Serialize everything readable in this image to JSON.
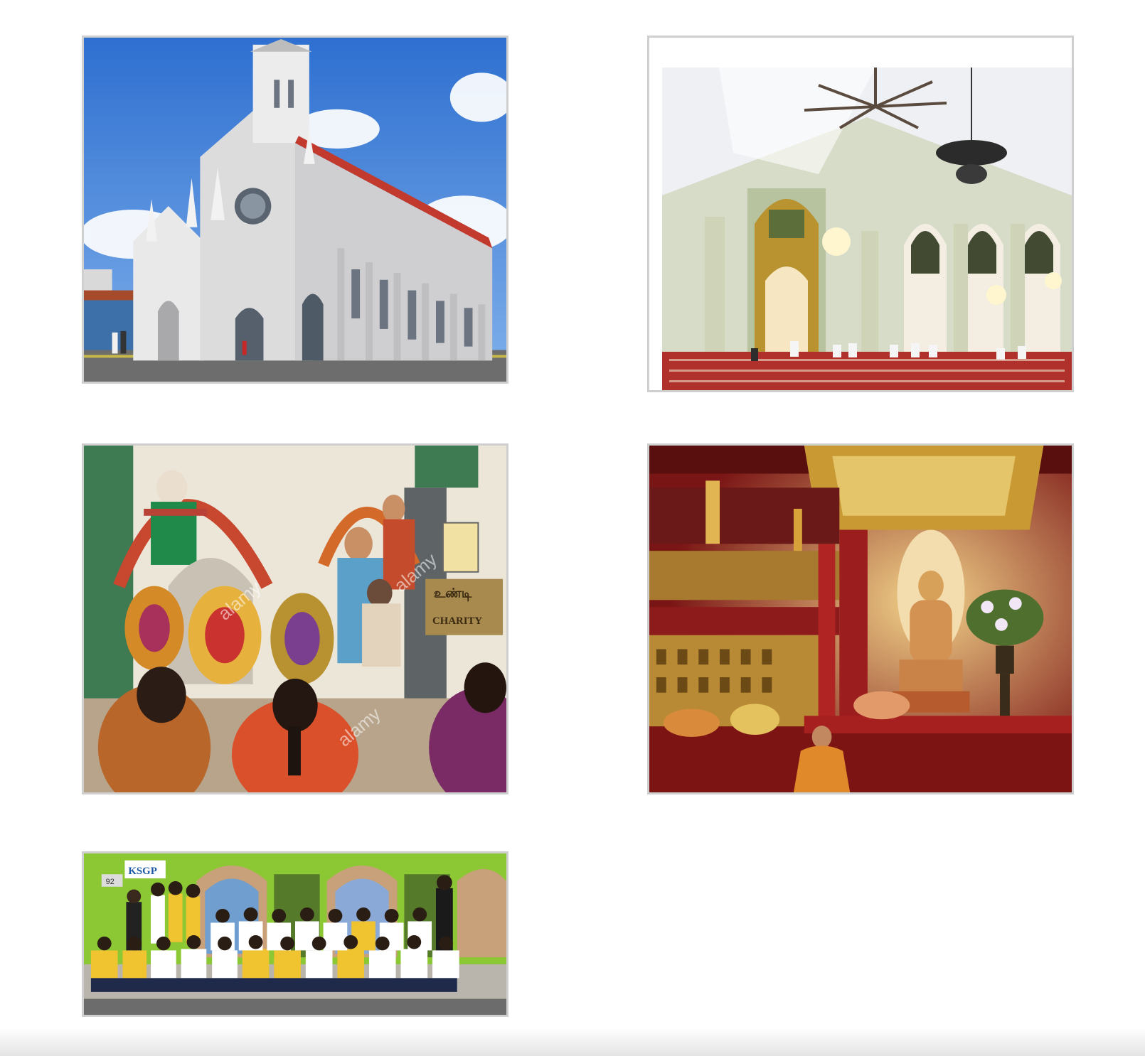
{
  "gallery": {
    "photos": [
      {
        "name": "church-photo",
        "subject": "church"
      },
      {
        "name": "mosque-interior-photo",
        "subject": "mosque"
      },
      {
        "name": "hindu-temple-photo",
        "subject": "hindu-temple",
        "watermark": "alamy",
        "sign_tamil": "உண்டி",
        "sign_charity": "CHARITY"
      },
      {
        "name": "buddhist-temple-photo",
        "subject": "buddhist-temple"
      },
      {
        "name": "student-group-photo",
        "subject": "student-group",
        "sign_logo": "KSGP",
        "sign_number": "92"
      }
    ]
  },
  "colors": {
    "frame_border": "#cfcfcf",
    "page_background": "#ffffff",
    "sky": "#4a86d6",
    "mosque_wall": "#c9d3b8",
    "temple_red": "#8e1b1b",
    "street_green": "#8bc833"
  }
}
